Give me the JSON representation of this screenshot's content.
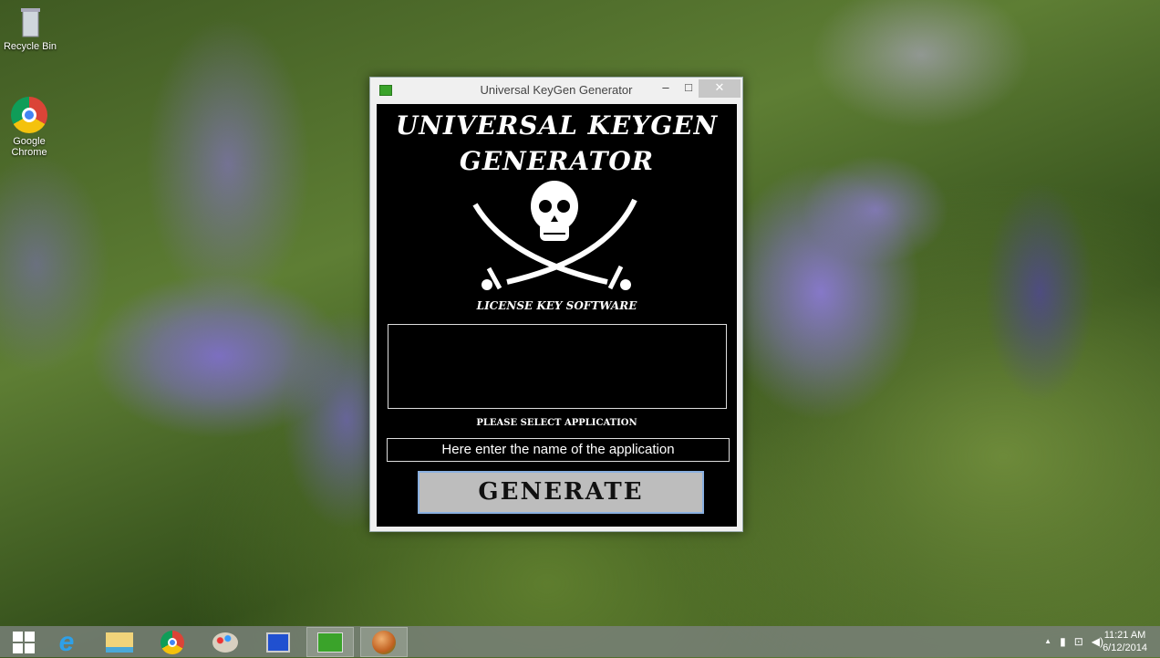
{
  "desktop": {
    "icons": [
      {
        "label": "Recycle Bin",
        "icon": "recycle-bin-icon"
      },
      {
        "label": "Google Chrome",
        "icon": "chrome-icon"
      }
    ]
  },
  "window": {
    "title": "Universal KeyGen Generator",
    "minimize": "–",
    "maximize": "□",
    "close": "✕"
  },
  "app": {
    "heading_line1": "UNIVERSAL KEYGEN",
    "heading_line2": "GENERATOR",
    "subtitle": "LICENSE KEY SOFTWARE",
    "output": "",
    "select_label": "PLEASE SELECT APPLICATION",
    "input_value": "Here enter the name of the application",
    "generate_label": "GENERATE"
  },
  "taskbar": {
    "items": [
      "start",
      "internet-explorer",
      "file-explorer",
      "chrome",
      "paint",
      "remote-desktop",
      "keygen",
      "app"
    ]
  },
  "tray": {
    "time": "11:21 AM",
    "date": "6/12/2014",
    "arrow": "▲"
  }
}
